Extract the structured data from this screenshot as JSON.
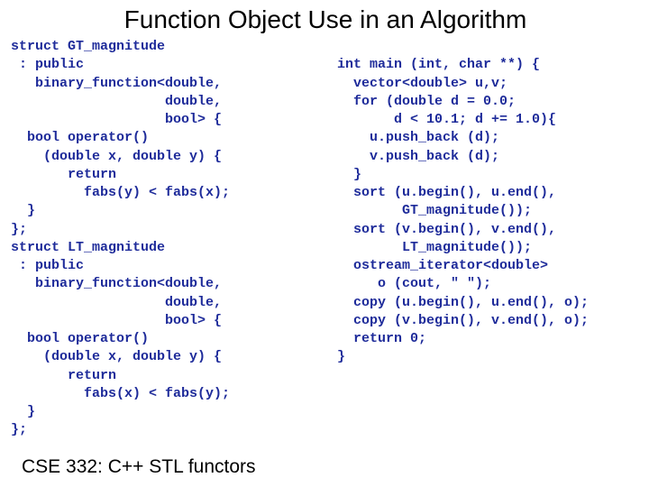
{
  "title": "Function Object Use in an Algorithm",
  "code_left": "struct GT_magnitude\n : public\n   binary_function<double,\n                   double,\n                   bool> {\n  bool operator()\n    (double x, double y) {\n       return\n         fabs(y) < fabs(x);\n  }\n};\nstruct LT_magnitude\n : public\n   binary_function<double,\n                   double,\n                   bool> {\n  bool operator()\n    (double x, double y) {\n       return\n         fabs(x) < fabs(y);\n  }\n};",
  "code_right": "\n  int main (int, char **) {\n    vector<double> u,v;\n    for (double d = 0.0;\n         d < 10.1; d += 1.0){\n      u.push_back (d);\n      v.push_back (d);\n    }\n    sort (u.begin(), u.end(),\n          GT_magnitude());\n    sort (v.begin(), v.end(),\n          LT_magnitude());\n    ostream_iterator<double>\n       o (cout, \" \");\n    copy (u.begin(), u.end(), o);\n    copy (v.begin(), v.end(), o);\n    return 0;\n  }",
  "footer": "CSE 332: C++ STL functors"
}
